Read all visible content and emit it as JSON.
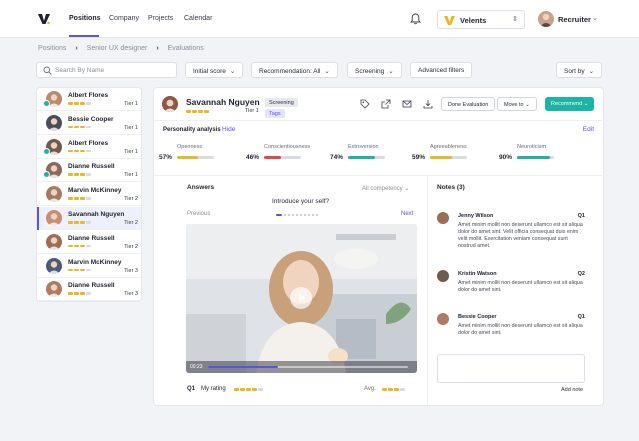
{
  "nav": {
    "positions": "Positions",
    "company": "Company",
    "projects": "Projects",
    "calendar": "Calendar"
  },
  "company_select": {
    "name": "Velents"
  },
  "user": {
    "role": "Recruiter"
  },
  "breadcrumb": [
    "Positions",
    "Senior UX designer",
    "Evaluations"
  ],
  "search": {
    "placeholder": "Search By Name"
  },
  "filters": {
    "initial_score": "Initial score",
    "recommendation": "Recommendation: All",
    "screening": "Screening",
    "advanced": "Advanced filters",
    "sort": "Sort by"
  },
  "candidates": [
    {
      "name": "Albert Flores",
      "tier": "Tier 1",
      "rating": 3,
      "checked": true,
      "color": "#b98a6e"
    },
    {
      "name": "Bessie Cooper",
      "tier": "Tier 1",
      "rating": 3,
      "checked": false,
      "color": "#4a4e5c"
    },
    {
      "name": "Albert Flores",
      "tier": "Tier 1",
      "rating": 3,
      "checked": true,
      "color": "#6f5a4e"
    },
    {
      "name": "Dianne Russell",
      "tier": "Tier 1",
      "rating": 3,
      "checked": true,
      "color": "#8a6a5a"
    },
    {
      "name": "Marvin McKinney",
      "tier": "Tier 2",
      "rating": 3,
      "checked": false,
      "color": "#a57a62"
    },
    {
      "name": "Savannah Nguyen",
      "tier": "Tier 2",
      "rating": 3,
      "checked": false,
      "color": "#c58f72"
    },
    {
      "name": "Dianne Russell",
      "tier": "Tier 2",
      "rating": 3,
      "checked": false,
      "color": "#9c6e58"
    },
    {
      "name": "Marvin McKinney",
      "tier": "Tier 3",
      "rating": 3,
      "checked": false,
      "color": "#4a5a7c"
    },
    {
      "name": "Dianne Russell",
      "tier": "Tier 3",
      "rating": 3,
      "checked": false,
      "color": "#b07a64"
    }
  ],
  "candidate": {
    "name": "Savannah Nguyen",
    "status": "Screening",
    "tags": "Tags",
    "tier": "Tier 1",
    "rating": 3
  },
  "actions": {
    "done": "Done Evaluation",
    "move": "Move to",
    "recommend": "Recommend"
  },
  "personality": {
    "title": "Personality analysis",
    "hide": "Hide",
    "edit": "Edit",
    "traits": [
      {
        "label": "Openness",
        "value": 57,
        "color": "#e8b923"
      },
      {
        "label": "Conscientiousness",
        "value": 46,
        "color": "#e0474c"
      },
      {
        "label": "Extroversion",
        "value": 74,
        "color": "#1cb5a3"
      },
      {
        "label": "Agreeableness",
        "value": 59,
        "color": "#e8b923"
      },
      {
        "label": "Neuroticism",
        "value": 90,
        "color": "#1cb5a3"
      }
    ]
  },
  "answers": {
    "title": "Answers",
    "competency": "All competency",
    "question": "Introduce your self?",
    "prev": "Previous",
    "next": "Next",
    "video_time": "00:23",
    "video_progress": 0.35,
    "q_label": "Q1",
    "my_rating": "My rating",
    "my_rating_value": 4,
    "avg_label": "Avg.",
    "avg_value": 3
  },
  "notes": {
    "title": "Notes (3)",
    "items": [
      {
        "name": "Jenny Wilson",
        "q": "Q1",
        "text": "Amet minim mollit non deserunt ullamco est sit aliqua dolor do amet sint. Velit officia consequat duis enim velit mollit. Exercitation veniam consequat sunt nostrud amet.",
        "color": "#9c6e58"
      },
      {
        "name": "Kristin Watson",
        "q": "Q2",
        "text": "Amet minim mollit non deserunt ullamco est sit aliqua dolor do amet sint.",
        "color": "#6f5a4e"
      },
      {
        "name": "Bessie Cooper",
        "q": "Q1",
        "text": "Amet minim mollit non deserunt ullamco est sit aliqua dolor do amet sint.",
        "color": "#b07a64"
      }
    ],
    "add": "Add note"
  }
}
